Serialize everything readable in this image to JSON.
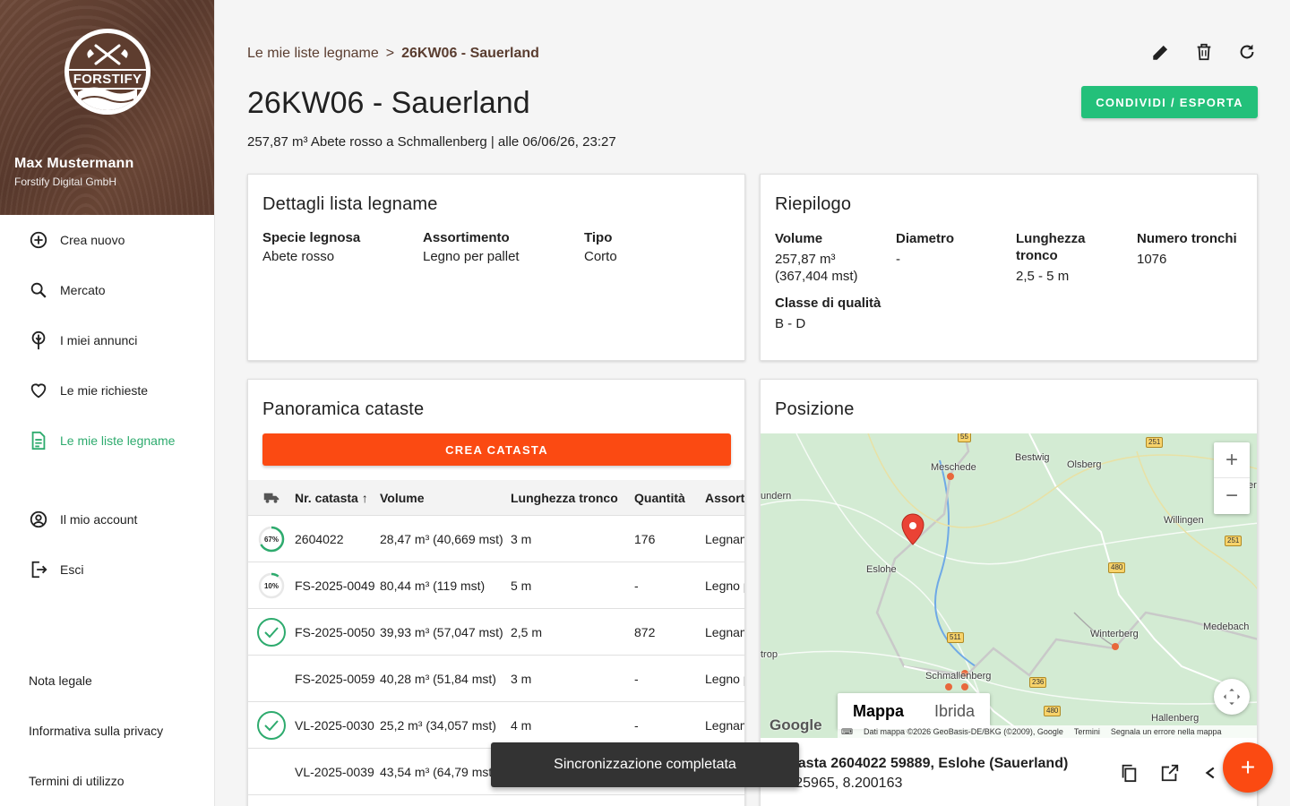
{
  "user": {
    "name": "Max Mustermann",
    "company": "Forstify Digital GmbH",
    "logo_text": "FORSTIFY"
  },
  "nav": {
    "items": [
      {
        "label": "Crea nuovo",
        "icon": "add-circle-icon"
      },
      {
        "label": "Mercato",
        "icon": "search-icon"
      },
      {
        "label": "I miei annunci",
        "icon": "tree-pin-icon"
      },
      {
        "label": "Le mie richieste",
        "icon": "heart-icon"
      },
      {
        "label": "Le mie liste legname",
        "icon": "list-document-icon",
        "active": true
      },
      {
        "label": "Il mio account",
        "icon": "account-circle-icon"
      },
      {
        "label": "Esci",
        "icon": "logout-icon"
      }
    ],
    "footer": [
      "Nota legale",
      "Informativa sulla privacy",
      "Termini di utilizzo"
    ]
  },
  "breadcrumb": {
    "parent": "Le mie liste legname",
    "separator": ">",
    "current": "26KW06 - Sauerland"
  },
  "header": {
    "title": "26KW06 - Sauerland",
    "subtitle": "257,87 m³ Abete rosso a Schmallenberg | alle 06/06/26, 23:27",
    "share_label": "CONDIVIDI / ESPORTA"
  },
  "details": {
    "title": "Dettagli lista legname",
    "fields": [
      {
        "label": "Specie legnosa",
        "value": "Abete rosso"
      },
      {
        "label": "Assortimento",
        "value": "Legno per pallet"
      },
      {
        "label": "Tipo",
        "value": "Corto"
      }
    ]
  },
  "summary": {
    "title": "Riepilogo",
    "volume_label": "Volume",
    "volume_value": "257,87 m³",
    "volume_value2": "(367,404 mst)",
    "diameter_label": "Diametro",
    "diameter_value": "-",
    "length_label1": "Lunghezza",
    "length_label2": "tronco",
    "length_value": "2,5 - 5 m",
    "count_label": "Numero tronchi",
    "count_value": "1076",
    "quality_label": "Classe di qualità",
    "quality_value": "B - D"
  },
  "piles": {
    "title": "Panoramica cataste",
    "create_label": "CREA CATASTA",
    "columns": [
      "Nr. catasta",
      "Volume",
      "Lunghezza tronco",
      "Quantità",
      "Assortimento"
    ],
    "rows": [
      {
        "status": "67%",
        "progress": 0.67,
        "nr": "2604022",
        "volume": "28,47 m³ (40,669 mst)",
        "length": "3 m",
        "qty": "176",
        "assort": "Legname"
      },
      {
        "status": "10%",
        "progress": 0.1,
        "nr": "FS-2025-0049",
        "volume": "80,44 m³ (119 mst)",
        "length": "5 m",
        "qty": "-",
        "assort": "Legno per pallet"
      },
      {
        "status": "done",
        "nr": "FS-2025-0050",
        "volume": "39,93 m³ (57,047 mst)",
        "length": "2,5 m",
        "qty": "872",
        "assort": "Legname"
      },
      {
        "status": "",
        "nr": "FS-2025-0059",
        "volume": "40,28 m³ (51,84 mst)",
        "length": "3 m",
        "qty": "-",
        "assort": "Legno per pallet"
      },
      {
        "status": "done",
        "nr": "VL-2025-0030",
        "volume": "25,2 m³ (34,057 mst)",
        "length": "4 m",
        "qty": "-",
        "assort": "Legname"
      },
      {
        "status": "",
        "nr": "VL-2025-0039",
        "volume": "43,54 m³ (64,79 mst)",
        "length": "",
        "qty": "",
        "assort": ""
      }
    ]
  },
  "position": {
    "title": "Posizione",
    "map_types": [
      "Mappa",
      "Ibrida"
    ],
    "places": [
      "Meschede",
      "Bestwig",
      "Olsberg",
      "undern",
      "Willingen",
      "Eslohe",
      "Winterberg",
      "Medebach",
      "trop",
      "Schmallenberg",
      "Hallenberg",
      "er"
    ],
    "roads": [
      "55",
      "251",
      "251",
      "480",
      "511",
      "236",
      "480"
    ],
    "google": "Google",
    "attribution": [
      "Dati mappa ©2026 GeoBasis-DE/BKG (©2009), Google",
      "Termini",
      "Segnala un errore nella mappa"
    ],
    "address_line1": "Catasta 2604022 59889, Eslohe (Sauerland)",
    "address_line2": "51.25965, 8.200163"
  },
  "toast": "Sincronizzazione completata",
  "colors": {
    "brand_brown": "#5e3d2f",
    "accent_green": "#23c07a",
    "accent_orange": "#fb4a12"
  }
}
